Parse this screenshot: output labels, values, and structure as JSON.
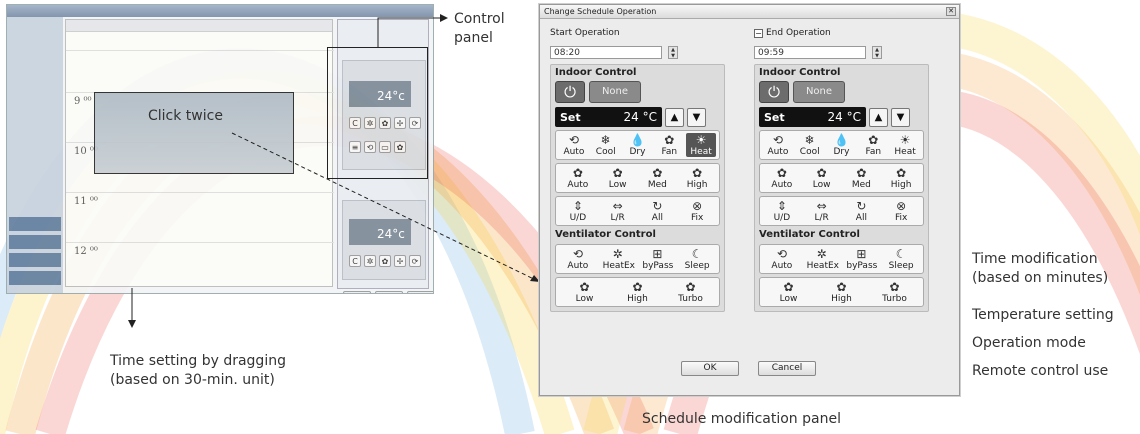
{
  "left_screenshot": {
    "hours": [
      "9 ⁰⁰",
      "10 ⁰⁰",
      "11 ⁰⁰",
      "12 ⁰⁰"
    ],
    "mini_temp_top": "24°c",
    "mini_temp_bottom": "24°c",
    "click_label": "Click twice"
  },
  "callouts": {
    "control_panel": "Control panel",
    "time_setting": "Time setting by dragging (based on 30-min. unit)",
    "time_modification": "Time modification (based on minutes)",
    "temperature_setting": "Temperature setting",
    "operation_mode": "Operation mode",
    "remote_control_use": "Remote control use",
    "caption": "Schedule modification panel"
  },
  "dialog": {
    "title": "Change Schedule Operation",
    "close_glyph": "✕",
    "ok_label": "OK",
    "cancel_label": "Cancel",
    "start": {
      "heading": "Start Operation",
      "time": "08:20",
      "indoor_title": "Indoor Control",
      "power_icon": "power-icon",
      "none_label": "None",
      "set_label": "Set",
      "set_temp": "24 °C",
      "modes": [
        {
          "icon": "auto-icon",
          "glyph": "⟲",
          "label": "Auto"
        },
        {
          "icon": "cool-icon",
          "glyph": "❄",
          "label": "Cool"
        },
        {
          "icon": "dry-icon",
          "glyph": "💧",
          "label": "Dry"
        },
        {
          "icon": "fan-icon",
          "glyph": "✿",
          "label": "Fan"
        },
        {
          "icon": "heat-icon",
          "glyph": "☀",
          "label": "Heat",
          "active": true
        }
      ],
      "fan_speeds": [
        {
          "icon": "fan-auto-icon",
          "glyph": "✿",
          "label": "Auto"
        },
        {
          "icon": "fan-low-icon",
          "glyph": "✿",
          "label": "Low"
        },
        {
          "icon": "fan-med-icon",
          "glyph": "✿",
          "label": "Med"
        },
        {
          "icon": "fan-high-icon",
          "glyph": "✿",
          "label": "High"
        }
      ],
      "swings": [
        {
          "icon": "swing-ud-icon",
          "glyph": "⇕",
          "label": "U/D"
        },
        {
          "icon": "swing-lr-icon",
          "glyph": "⇔",
          "label": "L/R"
        },
        {
          "icon": "swing-all-icon",
          "glyph": "↻",
          "label": "All"
        },
        {
          "icon": "swing-fix-icon",
          "glyph": "⊗",
          "label": "Fix"
        }
      ],
      "vent_title": "Ventilator Control",
      "vent_modes": [
        {
          "icon": "vent-auto-icon",
          "glyph": "⟲",
          "label": "Auto"
        },
        {
          "icon": "heatex-icon",
          "glyph": "✲",
          "label": "HeatEx"
        },
        {
          "icon": "bypass-icon",
          "glyph": "⊞",
          "label": "byPass"
        },
        {
          "icon": "sleep-icon",
          "glyph": "☾",
          "label": "Sleep"
        }
      ],
      "vent_speeds": [
        {
          "icon": "vent-low-icon",
          "glyph": "✿",
          "label": "Low"
        },
        {
          "icon": "vent-high-icon",
          "glyph": "✿",
          "label": "High"
        },
        {
          "icon": "turbo-icon",
          "glyph": "✿",
          "label": "Turbo"
        }
      ]
    },
    "end": {
      "heading": "End Operation",
      "check": "−",
      "time": "09:59",
      "indoor_title": "Indoor Control",
      "none_label": "None",
      "set_label": "Set",
      "set_temp": "24 °C",
      "modes": [
        {
          "icon": "auto-icon",
          "glyph": "⟲",
          "label": "Auto"
        },
        {
          "icon": "cool-icon",
          "glyph": "❄",
          "label": "Cool"
        },
        {
          "icon": "dry-icon",
          "glyph": "💧",
          "label": "Dry"
        },
        {
          "icon": "fan-icon",
          "glyph": "✿",
          "label": "Fan"
        },
        {
          "icon": "heat-icon",
          "glyph": "☀",
          "label": "Heat"
        }
      ],
      "fan_speeds": [
        {
          "icon": "fan-auto-icon",
          "glyph": "✿",
          "label": "Auto"
        },
        {
          "icon": "fan-low-icon",
          "glyph": "✿",
          "label": "Low"
        },
        {
          "icon": "fan-med-icon",
          "glyph": "✿",
          "label": "Med"
        },
        {
          "icon": "fan-high-icon",
          "glyph": "✿",
          "label": "High"
        }
      ],
      "swings": [
        {
          "icon": "swing-ud-icon",
          "glyph": "⇕",
          "label": "U/D"
        },
        {
          "icon": "swing-lr-icon",
          "glyph": "⇔",
          "label": "L/R"
        },
        {
          "icon": "swing-all-icon",
          "glyph": "↻",
          "label": "All"
        },
        {
          "icon": "swing-fix-icon",
          "glyph": "⊗",
          "label": "Fix"
        }
      ],
      "vent_title": "Ventilator Control",
      "vent_modes": [
        {
          "icon": "vent-auto-icon",
          "glyph": "⟲",
          "label": "Auto"
        },
        {
          "icon": "heatex-icon",
          "glyph": "✲",
          "label": "HeatEx"
        },
        {
          "icon": "bypass-icon",
          "glyph": "⊞",
          "label": "byPass"
        },
        {
          "icon": "sleep-icon",
          "glyph": "☾",
          "label": "Sleep"
        }
      ],
      "vent_speeds": [
        {
          "icon": "vent-low-icon",
          "glyph": "✿",
          "label": "Low"
        },
        {
          "icon": "vent-high-icon",
          "glyph": "✿",
          "label": "High"
        },
        {
          "icon": "turbo-icon",
          "glyph": "✿",
          "label": "Turbo"
        }
      ]
    }
  },
  "colors": {
    "arc_red": "#e8473a",
    "arc_orange": "#f59a2c",
    "arc_yellow": "#f7d64a",
    "arc_blue": "#5aa6d9"
  }
}
